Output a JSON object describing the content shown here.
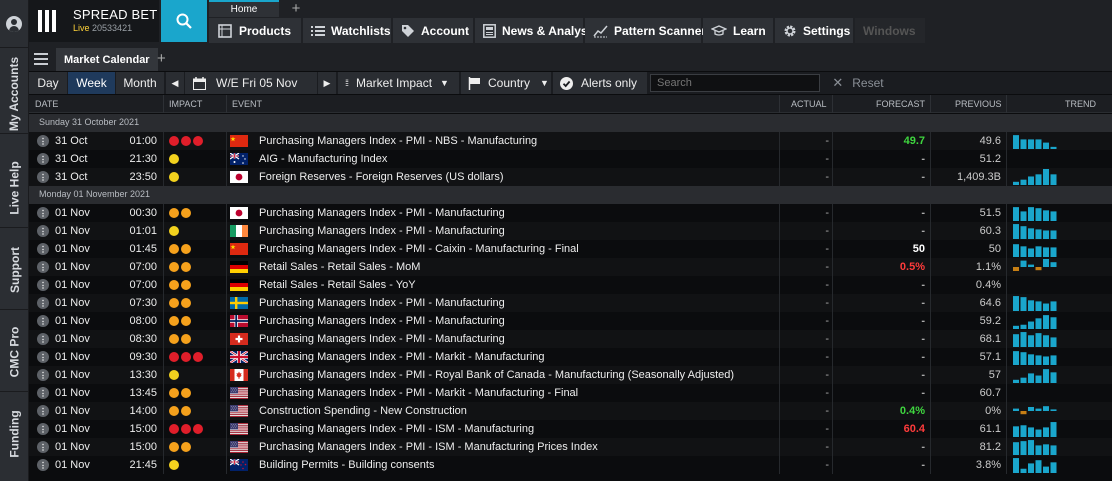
{
  "sidebar": {
    "items": [
      "My Accounts",
      "Live Help",
      "Support",
      "CMC Pro",
      "Funding"
    ]
  },
  "brand": {
    "name": "SPREAD BET",
    "status": "Live",
    "account": "20533421"
  },
  "tabs": {
    "home": "Home"
  },
  "nav": [
    {
      "label": "Products",
      "icon": "products-icon"
    },
    {
      "label": "Watchlists",
      "icon": "watchlist-icon"
    },
    {
      "label": "Account",
      "icon": "account-tag-icon"
    },
    {
      "label": "News & Analysis",
      "icon": "news-icon"
    },
    {
      "label": "Pattern Scanner",
      "icon": "pattern-scanner-icon"
    },
    {
      "label": "Learn",
      "icon": "graduation-cap-icon"
    },
    {
      "label": "Settings",
      "icon": "gear-icon"
    },
    {
      "label": "Windows",
      "icon": "windows-icon"
    }
  ],
  "panel": {
    "title": "Market Calendar"
  },
  "toolbar": {
    "day": "Day",
    "week": "Week",
    "month": "Month",
    "week_label": "W/E Fri 05 Nov",
    "impact": "Market Impact",
    "country": "Country",
    "alerts": "Alerts only",
    "search_placeholder": "Search",
    "reset": "Reset"
  },
  "columns": {
    "date": "DATE",
    "impact": "IMPACT",
    "event": "EVENT",
    "actual": "ACTUAL",
    "forecast": "FORECAST",
    "previous": "PREVIOUS",
    "trend": "TREND"
  },
  "colors": {
    "impact_high": "#e01e2a",
    "impact_med": "#f5a11c",
    "impact_low": "#f3d21e",
    "positive": "#3fd63f",
    "negative": "#ff3b3b",
    "trend_bar": "#1aa6cc",
    "trend_neg": "#c77f14"
  },
  "groups": [
    {
      "label": "Sunday 31 October 2021",
      "rows": [
        {
          "date": "31 Oct",
          "time": "01:00",
          "impact": 3,
          "country": "cn",
          "event": "Purchasing Managers Index - PMI - NBS - Manufacturing",
          "actual": "-",
          "forecast": "49.7",
          "fc_color": "positive",
          "previous": "49.6",
          "trend": [
            13,
            9,
            9,
            9,
            6,
            2
          ]
        },
        {
          "date": "31 Oct",
          "time": "21:30",
          "impact": 1,
          "country": "au",
          "event": "AIG - Manufacturing Index",
          "actual": "-",
          "forecast": "-",
          "previous": "51.2",
          "trend": []
        },
        {
          "date": "31 Oct",
          "time": "23:50",
          "impact": 1,
          "country": "jp",
          "event": "Foreign Reserves - Foreign Reserves (US dollars)",
          "actual": "-",
          "forecast": "-",
          "previous": "1,409.3B",
          "trend": [
            3,
            5,
            8,
            10,
            15,
            10
          ]
        }
      ]
    },
    {
      "label": "Monday 01 November 2021",
      "rows": [
        {
          "date": "01 Nov",
          "time": "00:30",
          "impact": 2,
          "country": "jp",
          "event": "Purchasing Managers Index - PMI - Manufacturing",
          "actual": "-",
          "forecast": "-",
          "previous": "51.5",
          "trend": [
            13,
            9,
            13,
            12,
            10,
            9
          ]
        },
        {
          "date": "01 Nov",
          "time": "01:01",
          "impact": 1,
          "country": "ie",
          "event": "Purchasing Managers Index - PMI - Manufacturing",
          "actual": "-",
          "forecast": "-",
          "previous": "60.3",
          "trend": [
            14,
            12,
            10,
            9,
            8,
            8
          ]
        },
        {
          "date": "01 Nov",
          "time": "01:45",
          "impact": 2,
          "country": "cn",
          "event": "Purchasing Managers Index - PMI - Caixin - Manufacturing - Final",
          "actual": "-",
          "forecast": "50",
          "fc_color": "neutral",
          "previous": "50",
          "trend": [
            12,
            10,
            8,
            10,
            9,
            9
          ]
        },
        {
          "date": "01 Nov",
          "time": "07:00",
          "impact": 2,
          "country": "de",
          "event": "Retail Sales - Retail Sales - MoM",
          "actual": "-",
          "forecast": "0.5%",
          "fc_color": "negative",
          "previous": "1.1%",
          "trend": [
            -5,
            8,
            3,
            -4,
            10,
            6
          ]
        },
        {
          "date": "01 Nov",
          "time": "07:00",
          "impact": 2,
          "country": "de",
          "event": "Retail Sales - Retail Sales - YoY",
          "actual": "-",
          "forecast": "-",
          "previous": "0.4%",
          "trend": []
        },
        {
          "date": "01 Nov",
          "time": "07:30",
          "impact": 2,
          "country": "se",
          "event": "Purchasing Managers Index - PMI - Manufacturing",
          "actual": "-",
          "forecast": "-",
          "previous": "64.6",
          "trend": [
            14,
            13,
            10,
            9,
            7,
            9
          ]
        },
        {
          "date": "01 Nov",
          "time": "08:00",
          "impact": 2,
          "country": "no",
          "event": "Purchasing Managers Index - PMI - Manufacturing",
          "actual": "-",
          "forecast": "-",
          "previous": "59.2",
          "trend": [
            3,
            4,
            7,
            10,
            13,
            11
          ]
        },
        {
          "date": "01 Nov",
          "time": "08:30",
          "impact": 2,
          "country": "ch",
          "event": "Purchasing Managers Index - PMI - Manufacturing",
          "actual": "-",
          "forecast": "-",
          "previous": "68.1",
          "trend": [
            12,
            14,
            11,
            13,
            11,
            9
          ]
        },
        {
          "date": "01 Nov",
          "time": "09:30",
          "impact": 3,
          "country": "gb",
          "event": "Purchasing Managers Index - PMI - Markit - Manufacturing",
          "actual": "-",
          "forecast": "-",
          "previous": "57.1",
          "trend": [
            13,
            12,
            10,
            9,
            8,
            9
          ]
        },
        {
          "date": "01 Nov",
          "time": "13:30",
          "impact": 1,
          "country": "ca",
          "event": "Purchasing Managers Index - PMI - Royal Bank of Canada - Manufacturing (Seasonally Adjusted)",
          "actual": "-",
          "forecast": "-",
          "previous": "57",
          "trend": [
            3,
            5,
            9,
            7,
            13,
            10
          ]
        },
        {
          "date": "01 Nov",
          "time": "13:45",
          "impact": 2,
          "country": "us",
          "event": "Purchasing Managers Index - PMI - Markit - Manufacturing - Final",
          "actual": "-",
          "forecast": "-",
          "previous": "60.7",
          "trend": []
        },
        {
          "date": "01 Nov",
          "time": "14:00",
          "impact": 2,
          "country": "us",
          "event": "Construction Spending - New Construction",
          "actual": "-",
          "forecast": "0.4%",
          "fc_color": "positive",
          "previous": "0%",
          "trend": [
            3,
            -4,
            5,
            3,
            6,
            2
          ]
        },
        {
          "date": "01 Nov",
          "time": "15:00",
          "impact": 3,
          "country": "us",
          "event": "Purchasing Managers Index - PMI - ISM - Manufacturing",
          "actual": "-",
          "forecast": "60.4",
          "fc_color": "negative",
          "previous": "61.1",
          "trend": [
            10,
            11,
            9,
            7,
            9,
            14
          ]
        },
        {
          "date": "01 Nov",
          "time": "15:00",
          "impact": 2,
          "country": "us",
          "event": "Purchasing Managers Index - PMI - ISM - Manufacturing Prices Index",
          "actual": "-",
          "forecast": "-",
          "previous": "81.2",
          "trend": [
            12,
            13,
            14,
            9,
            10,
            9
          ]
        },
        {
          "date": "01 Nov",
          "time": "21:45",
          "impact": 1,
          "country": "nz",
          "event": "Building Permits - Building consents",
          "actual": "-",
          "forecast": "-",
          "previous": "3.8%",
          "trend": [
            14,
            4,
            9,
            12,
            6,
            10
          ]
        }
      ]
    }
  ]
}
